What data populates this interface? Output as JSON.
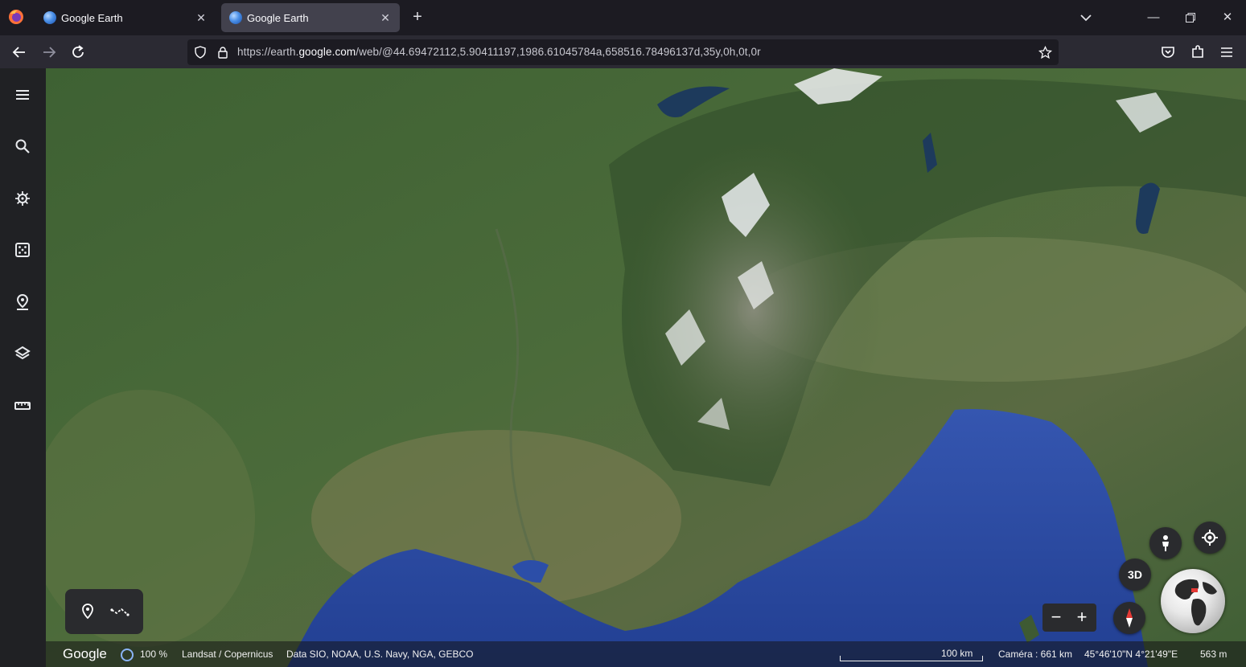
{
  "browser": {
    "tabs": [
      {
        "title": "Google Earth",
        "active": false
      },
      {
        "title": "Google Earth",
        "active": true
      }
    ],
    "url_prefix": "https://earth.",
    "url_domain": "google.com",
    "url_suffix": "/web/@44.69472112,5.90411197,1986.61045784a,658516.78496137d,35y,0h,0t,0r"
  },
  "sidebar": {
    "items": [
      {
        "icon": "menu-icon"
      },
      {
        "icon": "search-icon"
      },
      {
        "icon": "voyager-icon"
      },
      {
        "icon": "feeling-lucky-icon"
      },
      {
        "icon": "projects-icon"
      },
      {
        "icon": "map-style-icon"
      },
      {
        "icon": "measure-icon"
      }
    ]
  },
  "map": {
    "tools": [
      {
        "icon": "add-placemark-icon"
      },
      {
        "icon": "draw-path-icon"
      }
    ],
    "view_mode_label": "3D"
  },
  "status": {
    "brand": "Google",
    "loading_percent": "100 %",
    "imagery_credit": "Landsat / Copernicus",
    "data_credit": "Data SIO, NOAA, U.S. Navy, NGA, GEBCO",
    "scale_label": "100 km",
    "camera": "Caméra : 661 km",
    "coordinates": "45°46'10\"N 4°21'49\"E",
    "elevation": "563 m"
  },
  "colors": {
    "sea": "#2c4ea8",
    "land": "#4a6b3a",
    "snow": "#e9ecee",
    "sidebar_bg": "#202124"
  }
}
